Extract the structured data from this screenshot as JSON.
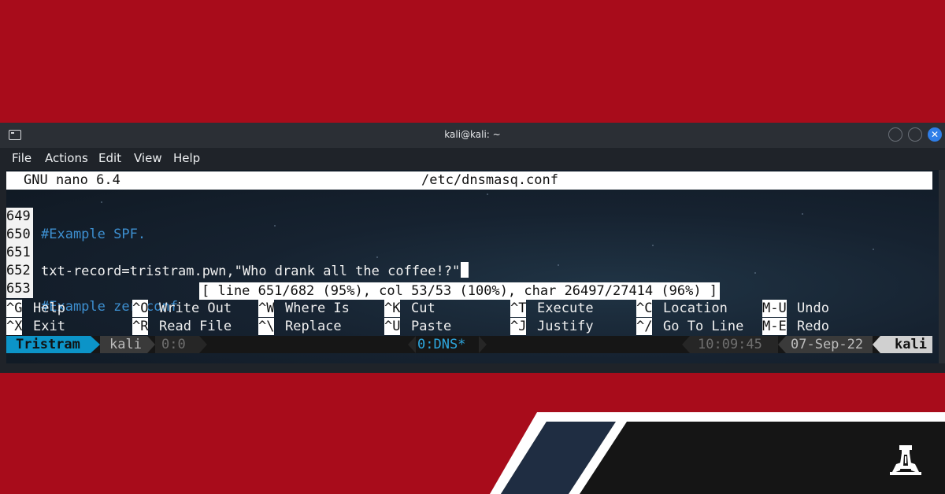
{
  "window": {
    "title": "kali@kali: ~",
    "close_glyph": "✕"
  },
  "menubar": {
    "items": [
      "File",
      "Actions",
      "Edit",
      "View",
      "Help"
    ]
  },
  "nano": {
    "version": "GNU nano 6.4",
    "filename": "/etc/dnsmasq.conf",
    "lines": [
      {
        "num": "649",
        "text": "#Example SPF.",
        "kind": "comment"
      },
      {
        "num": "650",
        "text": "",
        "kind": "plain"
      },
      {
        "num": "651",
        "text": "txt-record=tristram.pwn,\"Who drank all the coffee!?\"",
        "kind": "plain"
      },
      {
        "num": "652",
        "text": "",
        "kind": "plain"
      },
      {
        "num": "653",
        "text": "#Example zeroconf",
        "kind": "comment"
      }
    ],
    "status": "[ line 651/682 (95%), col 53/53 (100%), char 26497/27414 (96%) ]",
    "shortcuts_row1": [
      {
        "key": "^G",
        "label": "Help"
      },
      {
        "key": "^O",
        "label": "Write Out"
      },
      {
        "key": "^W",
        "label": "Where Is"
      },
      {
        "key": "^K",
        "label": "Cut"
      },
      {
        "key": "^T",
        "label": "Execute"
      },
      {
        "key": "^C",
        "label": "Location"
      },
      {
        "key": "M-U",
        "label": "Undo"
      }
    ],
    "shortcuts_row2": [
      {
        "key": "^X",
        "label": "Exit"
      },
      {
        "key": "^R",
        "label": "Read File"
      },
      {
        "key": "^\\",
        "label": "Replace"
      },
      {
        "key": "^U",
        "label": "Paste"
      },
      {
        "key": "^J",
        "label": "Justify"
      },
      {
        "key": "^/",
        "label": "Go To Line"
      },
      {
        "key": "M-E",
        "label": "Redo"
      }
    ]
  },
  "tmux": {
    "session": "Tristram",
    "host": "kali",
    "pane": "0:0",
    "window": "0:DNS*",
    "time": "10:09:45",
    "date": "07-Sep-22",
    "user": "kali"
  },
  "colors": {
    "background_red": "#a80c1b",
    "accent_blue": "#0c94c8",
    "comment_blue": "#3d8fd0",
    "navy_stripe": "#1f2d42",
    "dark_panel": "#151515"
  },
  "icons": [
    "terminal-icon",
    "minimize-icon",
    "maximize-icon",
    "close-icon",
    "brand-logo-icon"
  ]
}
